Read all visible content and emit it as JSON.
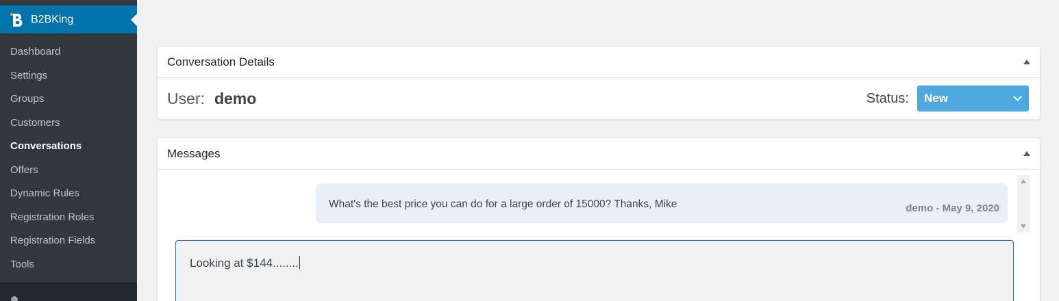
{
  "sidebar": {
    "brand": "B2BKing",
    "items": [
      {
        "label": "Dashboard",
        "active": false
      },
      {
        "label": "Settings",
        "active": false
      },
      {
        "label": "Groups",
        "active": false
      },
      {
        "label": "Customers",
        "active": false
      },
      {
        "label": "Conversations",
        "active": true
      },
      {
        "label": "Offers",
        "active": false
      },
      {
        "label": "Dynamic Rules",
        "active": false
      },
      {
        "label": "Registration Roles",
        "active": false
      },
      {
        "label": "Registration Fields",
        "active": false
      },
      {
        "label": "Tools",
        "active": false
      }
    ]
  },
  "details": {
    "title": "Conversation Details",
    "user_label": "User:",
    "user_value": "demo",
    "status_label": "Status:",
    "status_value": "New"
  },
  "messages": {
    "title": "Messages",
    "items": [
      {
        "text": "What's the best price you can do for a large order of 15000? Thanks, Mike",
        "meta": "demo - May 9, 2020"
      }
    ],
    "reply_value": "Looking at $144........"
  },
  "colors": {
    "brand": "#0073aa",
    "status_select": "#4fa7e0",
    "bubble": "#e8eff6",
    "sidebar": "#23282d"
  }
}
